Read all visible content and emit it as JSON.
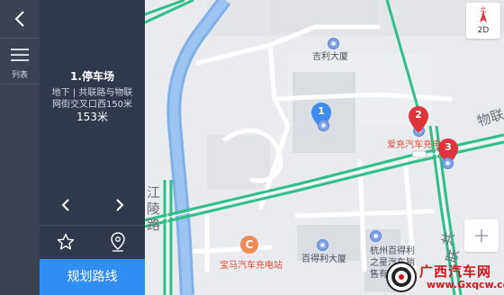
{
  "nav": {
    "back_icon": "chevron-left-icon",
    "list_label": "列表"
  },
  "poi": {
    "title": "1.停车场",
    "line1": "地下 | 共联路与物联",
    "line2": "网街交叉口西150米",
    "distance": "153米"
  },
  "actions": {
    "prev_icon": "chevron-left-icon",
    "next_icon": "chevron-right-icon",
    "favorite_icon": "star-icon",
    "location_icon": "location-pin-icon",
    "plan_route_label": "规划路线"
  },
  "controls": {
    "compass_north": "北",
    "view_mode": "2D",
    "zoom_in_icon": "plus-icon"
  },
  "map": {
    "labels": {
      "jili_building": "吉利大厦",
      "aichong_station": "爱充汽车充电站",
      "baoma_station": "宝马汽车充电站",
      "baidli_building": "百得利大厦",
      "hangzhou_a": "杭州百得利",
      "hangzhou_b": "之星汽车销",
      "hangzhou_c": "售有限公司"
    },
    "roads": {
      "wulian": "物联",
      "jiangling_a": "江",
      "jiangling_b": "陵",
      "jiangling_c": "路",
      "gonglian_a": "共",
      "gonglian_b": "联"
    },
    "pins": [
      "1",
      "2",
      "3"
    ],
    "pin_colors": {
      "selected": "#3d8ef0",
      "other": "#e0343a"
    },
    "road_color": "#2fc08a",
    "river_color": "#7fb1e8"
  },
  "watermark": {
    "title": "广西汽车网",
    "url": "www.Gxqcw.com"
  }
}
